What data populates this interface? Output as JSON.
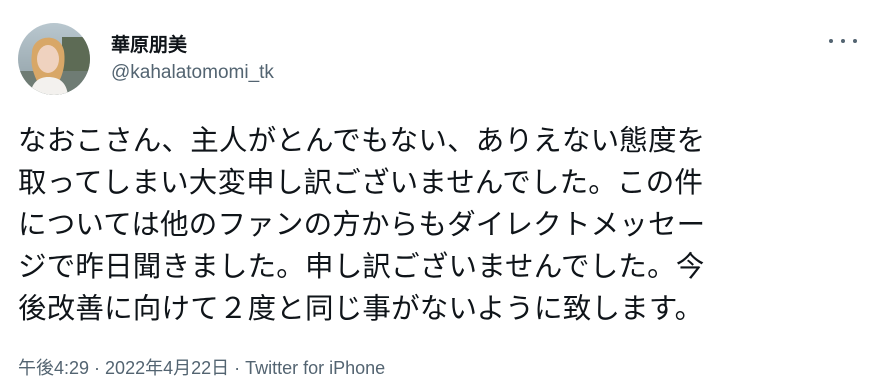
{
  "user": {
    "display_name": "華原朋美",
    "handle": "@kahalatomomi_tk"
  },
  "more_menu": {
    "icon": "more-horizontal-icon"
  },
  "tweet": {
    "lines": [
      "なおこさん、主人がとんでもない、ありえない態度を",
      "取ってしまい大変申し訳ございませんでした。この件",
      "については他のファンの方からもダイレクトメッセー",
      "ジで昨日聞きました。申し訳ございませんでした。今",
      "後改善に向けて２度と同じ事がないように致します。"
    ]
  },
  "meta": {
    "time": "午後4:29",
    "separator": " · ",
    "date": "2022年4月22日",
    "source": "Twitter for iPhone"
  }
}
